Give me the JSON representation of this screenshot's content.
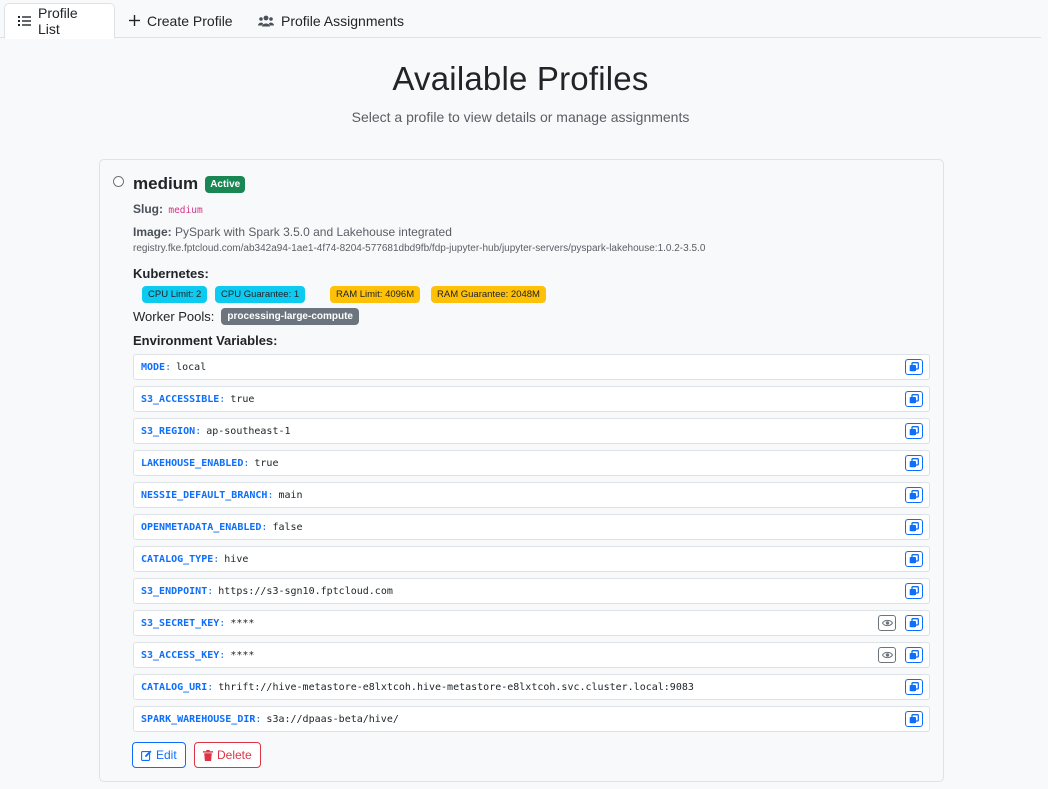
{
  "tabs": [
    {
      "label": "Profile List",
      "icon": "list-icon",
      "active": true
    },
    {
      "label": "Create Profile",
      "icon": "plus-icon",
      "active": false
    },
    {
      "label": "Profile Assignments",
      "icon": "users-icon",
      "active": false
    }
  ],
  "header": {
    "title": "Available Profiles",
    "subtitle": "Select a profile to view details or manage assignments"
  },
  "profile": {
    "name": "medium",
    "status": "Active",
    "slug_label": "Slug:",
    "slug": "medium",
    "image_label": "Image:",
    "image_desc": "PySpark with Spark 3.5.0 and Lakehouse integrated",
    "image_path": "registry.fke.fptcloud.com/ab342a94-1ae1-4f74-8204-577681dbd9fb/fdp-jupyter-hub/jupyter-servers/pyspark-lakehouse:1.0.2-3.5.0",
    "kubernetes_label": "Kubernetes:",
    "resources": [
      "CPU Limit: 2",
      "CPU Guarantee: 1",
      "RAM Limit: 4096M",
      "RAM Guarantee: 2048M"
    ],
    "worker_pools_label": "Worker Pools:",
    "worker_pool": "processing-large-compute",
    "env_label": "Environment Variables:",
    "env": [
      {
        "key": "MODE",
        "value": "local"
      },
      {
        "key": "S3_ACCESSIBLE",
        "value": "true"
      },
      {
        "key": "S3_REGION",
        "value": "ap-southeast-1"
      },
      {
        "key": "LAKEHOUSE_ENABLED",
        "value": "true"
      },
      {
        "key": "NESSIE_DEFAULT_BRANCH",
        "value": "main"
      },
      {
        "key": "OPENMETADATA_ENABLED",
        "value": "false"
      },
      {
        "key": "CATALOG_TYPE",
        "value": "hive"
      },
      {
        "key": "S3_ENDPOINT",
        "value": "https://s3-sgn10.fptcloud.com"
      },
      {
        "key": "S3_SECRET_KEY",
        "value": "****",
        "secret": true
      },
      {
        "key": "S3_ACCESS_KEY",
        "value": "****",
        "secret": true
      },
      {
        "key": "CATALOG_URI",
        "value": "thrift://hive-metastore-e8lxtcoh.hive-metastore-e8lxtcoh.svc.cluster.local:9083"
      },
      {
        "key": "SPARK_WAREHOUSE_DIR",
        "value": "s3a://dpaas-beta/hive/"
      }
    ],
    "actions": {
      "edit": "Edit",
      "delete": "Delete"
    }
  }
}
